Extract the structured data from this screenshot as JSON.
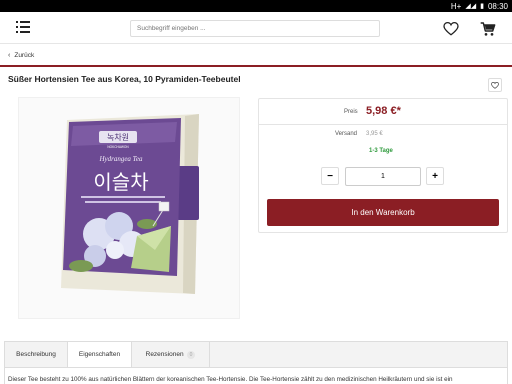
{
  "statusbar": {
    "network": "H+",
    "time": "08:30"
  },
  "header": {
    "search_placeholder": "Suchbegriff eingeben ...",
    "menu_icon": "hamburger-menu-icon",
    "wishlist_icon": "heart-icon",
    "cart_icon": "cart-icon"
  },
  "nav": {
    "back_label": "Zurück"
  },
  "product": {
    "title": "Süßer Hortensien Tee aus Korea, 10 Pyramiden-Teebeutel",
    "image": {
      "brand_korean": "녹차원",
      "brand_latin": "NOKCHAWON",
      "product_latin": "Hydrangea Tea",
      "product_korean": "이슬차"
    }
  },
  "buybox": {
    "price_label": "Preis",
    "price_value": "5,98 €*",
    "shipping_label": "Versand",
    "shipping_value": "3,95 €",
    "delivery_time": "1-3 Tage",
    "qty_minus": "−",
    "qty_plus": "+",
    "quantity": "1",
    "add_to_cart": "In den Warenkorb"
  },
  "tabs": [
    {
      "label": "Beschreibung"
    },
    {
      "label": "Eigenschaften"
    },
    {
      "label": "Rezensionen",
      "badge": "0"
    }
  ],
  "description": "Dieser Tee besteht zu 100% aus natürlichen Blättern der koreanischen Tee-Hortensie. Die Tee-Hortensie zählt zu den medizinischen Heilkräutern und sie ist ein",
  "colors": {
    "accent": "#8b1e24",
    "delivery_green": "#2e9a3c"
  }
}
